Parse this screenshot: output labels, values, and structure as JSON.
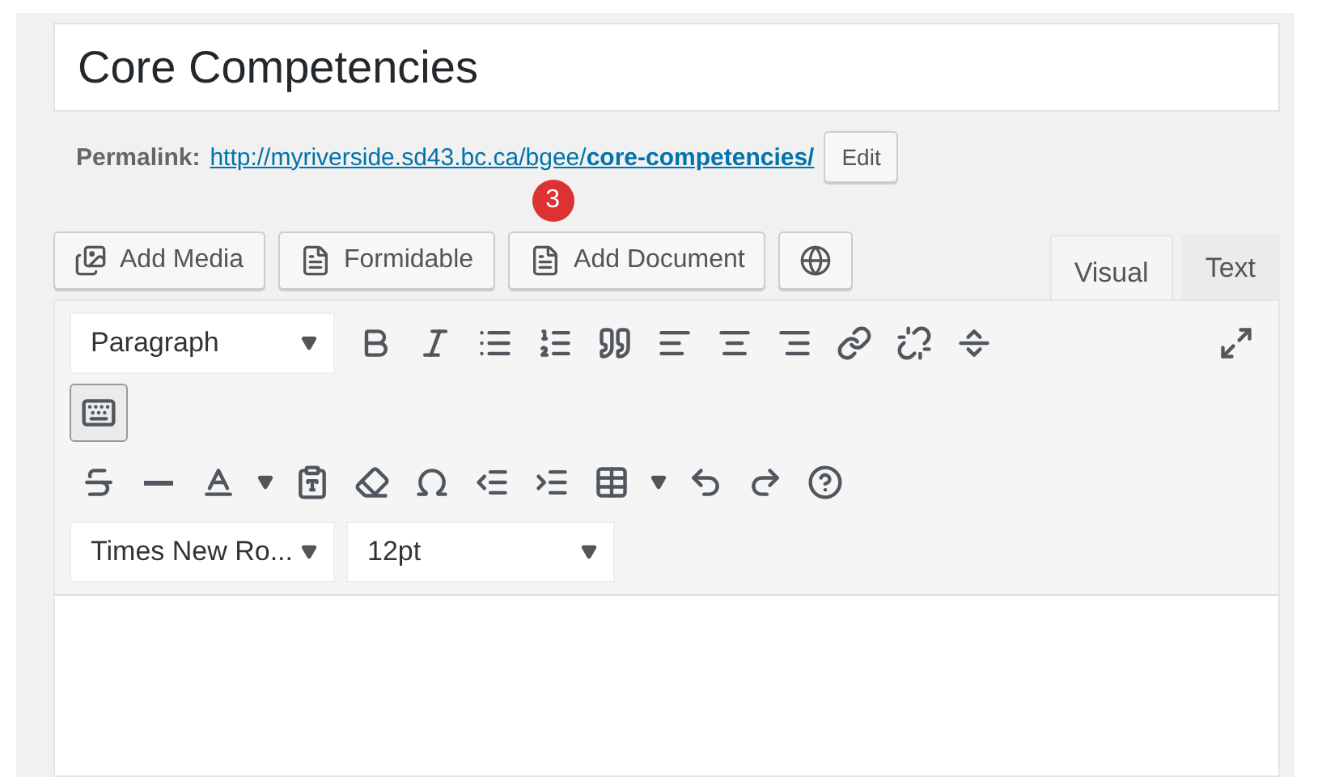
{
  "title_field": {
    "value": "Core Competencies"
  },
  "permalink": {
    "label": "Permalink:",
    "url": "http://myriverside.sd43.bc.ca/bgee/**core-competencies/**",
    "edit_button": "Edit"
  },
  "badge": "3",
  "media_buttons": [
    {
      "kind": "media",
      "label": "Add Media"
    },
    {
      "kind": "form",
      "label": "Formidable"
    },
    {
      "kind": "document",
      "label": "Add Document"
    },
    {
      "kind": "globe"
    }
  ],
  "editor_tabs": [
    {
      "label": "Visual",
      "selected": true
    },
    {
      "label": "Text",
      "selected": false
    }
  ],
  "toolbar": {
    "rows": [
      {
        "items": [
          {
            "kind": "select",
            "value": "Paragraph"
          },
          {
            "kind": "bold"
          },
          {
            "kind": "italic"
          },
          {
            "kind": "bullets"
          },
          {
            "kind": "numbers"
          },
          {
            "kind": "quote"
          },
          {
            "kind": "align-left"
          },
          {
            "kind": "align-center"
          },
          {
            "kind": "align-right"
          },
          {
            "kind": "link"
          },
          {
            "kind": "unlink"
          },
          {
            "kind": "more"
          },
          {
            "kind": "fullscreen"
          }
        ]
      },
      {
        "items": [
          {
            "kind": "toggle",
            "pressed": true
          }
        ]
      },
      {
        "items": [
          {
            "kind": "strike"
          },
          {
            "kind": "hr"
          },
          {
            "kind": "textcolor"
          },
          {
            "kind": "caret"
          },
          {
            "kind": "paste"
          },
          {
            "kind": "eraser"
          },
          {
            "kind": "omega"
          },
          {
            "kind": "outdent"
          },
          {
            "kind": "indent"
          },
          {
            "kind": "table"
          },
          {
            "kind": "caret"
          },
          {
            "kind": "undo"
          },
          {
            "kind": "redo"
          },
          {
            "kind": "help"
          }
        ]
      },
      {
        "items": [
          {
            "kind": "select",
            "value": "Times New Ro..."
          },
          {
            "kind": "select",
            "value": "12pt"
          }
        ]
      }
    ]
  }
}
